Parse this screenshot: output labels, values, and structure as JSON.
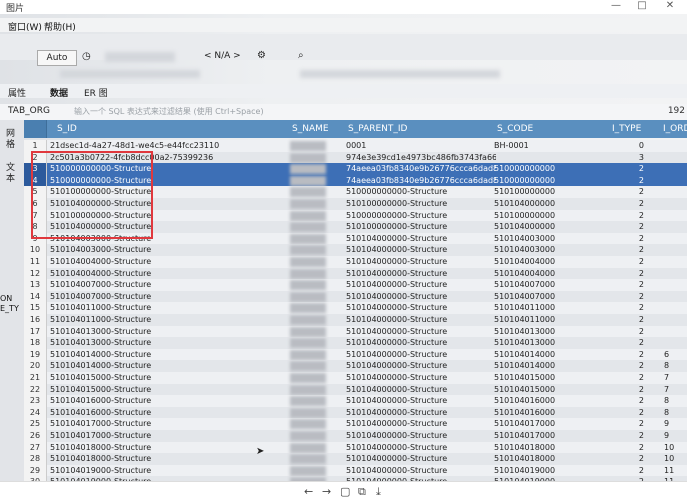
{
  "window": {
    "title": "图片",
    "controls": [
      "—",
      "□",
      "✕"
    ]
  },
  "menu": [
    "窗口(W)",
    "帮助(H)"
  ],
  "toolbar": {
    "mode": "Auto",
    "na": "< N/A >"
  },
  "tabs": [
    "属性",
    "数据",
    "ER 图"
  ],
  "filter": {
    "table": "TAB_ORG",
    "placeholder": "输入一个 SQL 表达式来过滤结果 (使用 Ctrl+Space)",
    "right": "192"
  },
  "sidebar": [
    "网",
    "格",
    "文",
    "本"
  ],
  "edge_left": [
    "ON",
    "E_TY"
  ],
  "columns": [
    "S_ID",
    "S_NAME",
    "S_PARENT_ID",
    "S_CODE",
    "I_TYPE",
    "I_ORD"
  ],
  "rows": [
    {
      "n": "1",
      "sid": "21dsec1d-4a27-48d1-we4c5-e44fcc23110",
      "par": "0001",
      "code": "BH-0001",
      "type": "0",
      "ord": ""
    },
    {
      "n": "2",
      "sid": "2c501a3b0722-4fcb8dcc00a2-75399236",
      "par": "974e3e39cd1e4973bc486fb3743fa66c",
      "code": "",
      "type": "3",
      "ord": ""
    },
    {
      "n": "3",
      "sid": "510000000000-Structure",
      "par": "74aeea03fb8340e9b26776ccca6dad82",
      "code": "510000000000",
      "type": "2",
      "ord": ""
    },
    {
      "n": "4",
      "sid": "510000000000-Structure",
      "par": "74aeea03fb8340e9b26776ccca6dad82",
      "code": "510000000000",
      "type": "2",
      "ord": ""
    },
    {
      "n": "5",
      "sid": "510100000000-Structure",
      "par": "510000000000-Structure",
      "code": "510100000000",
      "type": "2",
      "ord": ""
    },
    {
      "n": "6",
      "sid": "510104000000-Structure",
      "par": "510100000000-Structure",
      "code": "510104000000",
      "type": "2",
      "ord": ""
    },
    {
      "n": "7",
      "sid": "510100000000-Structure",
      "par": "510000000000-Structure",
      "code": "510100000000",
      "type": "2",
      "ord": ""
    },
    {
      "n": "8",
      "sid": "510104000000-Structure",
      "par": "510100000000-Structure",
      "code": "510104000000",
      "type": "2",
      "ord": ""
    },
    {
      "n": "9",
      "sid": "510104003000-Structure",
      "par": "510104000000-Structure",
      "code": "510104003000",
      "type": "2",
      "ord": ""
    },
    {
      "n": "10",
      "sid": "510104003000-Structure",
      "par": "510104000000-Structure",
      "code": "510104003000",
      "type": "2",
      "ord": ""
    },
    {
      "n": "11",
      "sid": "510104004000-Structure",
      "par": "510104000000-Structure",
      "code": "510104004000",
      "type": "2",
      "ord": ""
    },
    {
      "n": "12",
      "sid": "510104004000-Structure",
      "par": "510104000000-Structure",
      "code": "510104004000",
      "type": "2",
      "ord": ""
    },
    {
      "n": "13",
      "sid": "510104007000-Structure",
      "par": "510104000000-Structure",
      "code": "510104007000",
      "type": "2",
      "ord": ""
    },
    {
      "n": "14",
      "sid": "510104007000-Structure",
      "par": "510104000000-Structure",
      "code": "510104007000",
      "type": "2",
      "ord": ""
    },
    {
      "n": "15",
      "sid": "510104011000-Structure",
      "par": "510104000000-Structure",
      "code": "510104011000",
      "type": "2",
      "ord": ""
    },
    {
      "n": "16",
      "sid": "510104011000-Structure",
      "par": "510104000000-Structure",
      "code": "510104011000",
      "type": "2",
      "ord": ""
    },
    {
      "n": "17",
      "sid": "510104013000-Structure",
      "par": "510104000000-Structure",
      "code": "510104013000",
      "type": "2",
      "ord": ""
    },
    {
      "n": "18",
      "sid": "510104013000-Structure",
      "par": "510104000000-Structure",
      "code": "510104013000",
      "type": "2",
      "ord": ""
    },
    {
      "n": "19",
      "sid": "510104014000-Structure",
      "par": "510104000000-Structure",
      "code": "510104014000",
      "type": "2",
      "ord": "6"
    },
    {
      "n": "20",
      "sid": "510104014000-Structure",
      "par": "510104000000-Structure",
      "code": "510104014000",
      "type": "2",
      "ord": "8"
    },
    {
      "n": "21",
      "sid": "510104015000-Structure",
      "par": "510104000000-Structure",
      "code": "510104015000",
      "type": "2",
      "ord": "7"
    },
    {
      "n": "22",
      "sid": "510104015000-Structure",
      "par": "510104000000-Structure",
      "code": "510104015000",
      "type": "2",
      "ord": "7"
    },
    {
      "n": "23",
      "sid": "510104016000-Structure",
      "par": "510104000000-Structure",
      "code": "510104016000",
      "type": "2",
      "ord": "8"
    },
    {
      "n": "24",
      "sid": "510104016000-Structure",
      "par": "510104000000-Structure",
      "code": "510104016000",
      "type": "2",
      "ord": "8"
    },
    {
      "n": "25",
      "sid": "510104017000-Structure",
      "par": "510104000000-Structure",
      "code": "510104017000",
      "type": "2",
      "ord": "9"
    },
    {
      "n": "26",
      "sid": "510104017000-Structure",
      "par": "510104000000-Structure",
      "code": "510104017000",
      "type": "2",
      "ord": "9"
    },
    {
      "n": "27",
      "sid": "510104018000-Structure",
      "par": "510104000000-Structure",
      "code": "510104018000",
      "type": "2",
      "ord": "10"
    },
    {
      "n": "28",
      "sid": "510104018000-Structure",
      "par": "510104000000-Structure",
      "code": "510104018000",
      "type": "2",
      "ord": "10"
    },
    {
      "n": "29",
      "sid": "510104019000-Structure",
      "par": "510104000000-Structure",
      "code": "510104019000",
      "type": "2",
      "ord": "11"
    },
    {
      "n": "30",
      "sid": "510104019000-Structure",
      "par": "510104000000-Structure",
      "code": "510104019000",
      "type": "2",
      "ord": "11"
    }
  ],
  "bottom": [
    "←",
    "→",
    "▢",
    "⧉",
    "⤓"
  ]
}
